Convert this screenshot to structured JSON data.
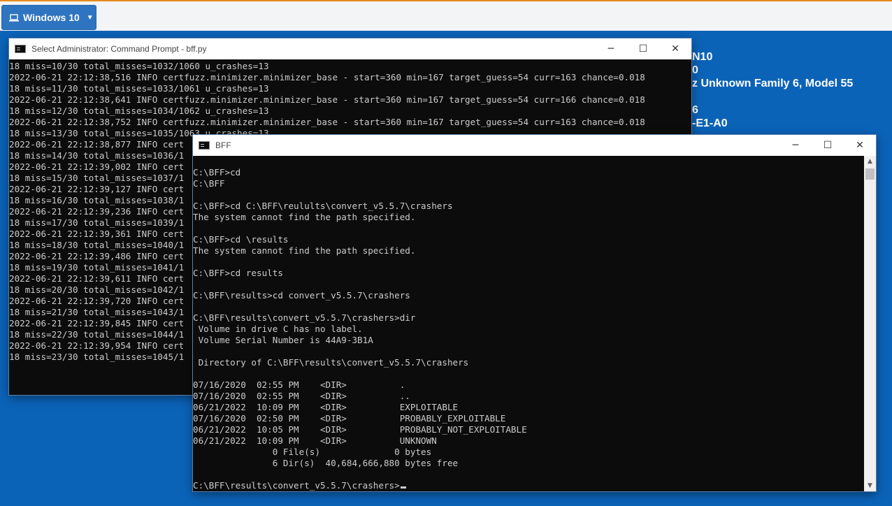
{
  "vm_tab": {
    "label": "Windows 10",
    "icon": "laptop-icon"
  },
  "bginfo": [
    {
      "text": "N10"
    },
    {
      "text": "0"
    },
    {
      "text": "z Unknown Family 6, Model 55"
    },
    {
      "text": "6"
    },
    {
      "text": "-E1-A0"
    }
  ],
  "cmd_window": {
    "title": "Select Administrator: Command Prompt - bff.py",
    "lines": [
      "18 miss=10/30 total_misses=1032/1060 u_crashes=13",
      "2022-06-21 22:12:38,516 INFO certfuzz.minimizer.minimizer_base - start=360 min=167 target_guess=54 curr=163 chance=0.018",
      "18 miss=11/30 total_misses=1033/1061 u_crashes=13",
      "2022-06-21 22:12:38,641 INFO certfuzz.minimizer.minimizer_base - start=360 min=167 target_guess=54 curr=166 chance=0.018",
      "18 miss=12/30 total_misses=1034/1062 u_crashes=13",
      "2022-06-21 22:12:38,752 INFO certfuzz.minimizer.minimizer_base - start=360 min=167 target_guess=54 curr=163 chance=0.018",
      "18 miss=13/30 total_misses=1035/1063 u_crashes=13",
      "2022-06-21 22:12:38,877 INFO cert",
      "18 miss=14/30 total_misses=1036/1",
      "2022-06-21 22:12:39,002 INFO cert",
      "18 miss=15/30 total_misses=1037/1",
      "2022-06-21 22:12:39,127 INFO cert",
      "18 miss=16/30 total_misses=1038/1",
      "2022-06-21 22:12:39,236 INFO cert",
      "18 miss=17/30 total_misses=1039/1",
      "2022-06-21 22:12:39,361 INFO cert",
      "18 miss=18/30 total_misses=1040/1",
      "2022-06-21 22:12:39,486 INFO cert",
      "18 miss=19/30 total_misses=1041/1",
      "2022-06-21 22:12:39,611 INFO cert",
      "18 miss=20/30 total_misses=1042/1",
      "2022-06-21 22:12:39,720 INFO cert",
      "18 miss=21/30 total_misses=1043/1",
      "2022-06-21 22:12:39,845 INFO cert",
      "18 miss=22/30 total_misses=1044/1",
      "2022-06-21 22:12:39,954 INFO cert",
      "18 miss=23/30 total_misses=1045/1"
    ]
  },
  "bff_window": {
    "title": "BFF",
    "lines": [
      "",
      "C:\\BFF>cd",
      "C:\\BFF",
      "",
      "C:\\BFF>cd C:\\BFF\\reulults\\convert_v5.5.7\\crashers",
      "The system cannot find the path specified.",
      "",
      "C:\\BFF>cd \\results",
      "The system cannot find the path specified.",
      "",
      "C:\\BFF>cd results",
      "",
      "C:\\BFF\\results>cd convert_v5.5.7\\crashers",
      "",
      "C:\\BFF\\results\\convert_v5.5.7\\crashers>dir",
      " Volume in drive C has no label.",
      " Volume Serial Number is 44A9-3B1A",
      "",
      " Directory of C:\\BFF\\results\\convert_v5.5.7\\crashers",
      "",
      "07/16/2020  02:55 PM    <DIR>          .",
      "07/16/2020  02:55 PM    <DIR>          ..",
      "06/21/2022  10:09 PM    <DIR>          EXPLOITABLE",
      "07/16/2020  02:50 PM    <DIR>          PROBABLY_EXPLOITABLE",
      "06/21/2022  10:05 PM    <DIR>          PROBABLY_NOT_EXPLOITABLE",
      "06/21/2022  10:09 PM    <DIR>          UNKNOWN",
      "               0 File(s)              0 bytes",
      "               6 Dir(s)  40,684,666,880 bytes free",
      ""
    ],
    "prompt": "C:\\BFF\\results\\convert_v5.5.7\\crashers>"
  },
  "window_controls": {
    "minimize": "─",
    "maximize": "☐",
    "close": "✕"
  },
  "colors": {
    "desktop": "#0b63b8",
    "console_bg": "#0c0c0c",
    "console_fg": "#cccccc",
    "accent": "#e8891c"
  }
}
